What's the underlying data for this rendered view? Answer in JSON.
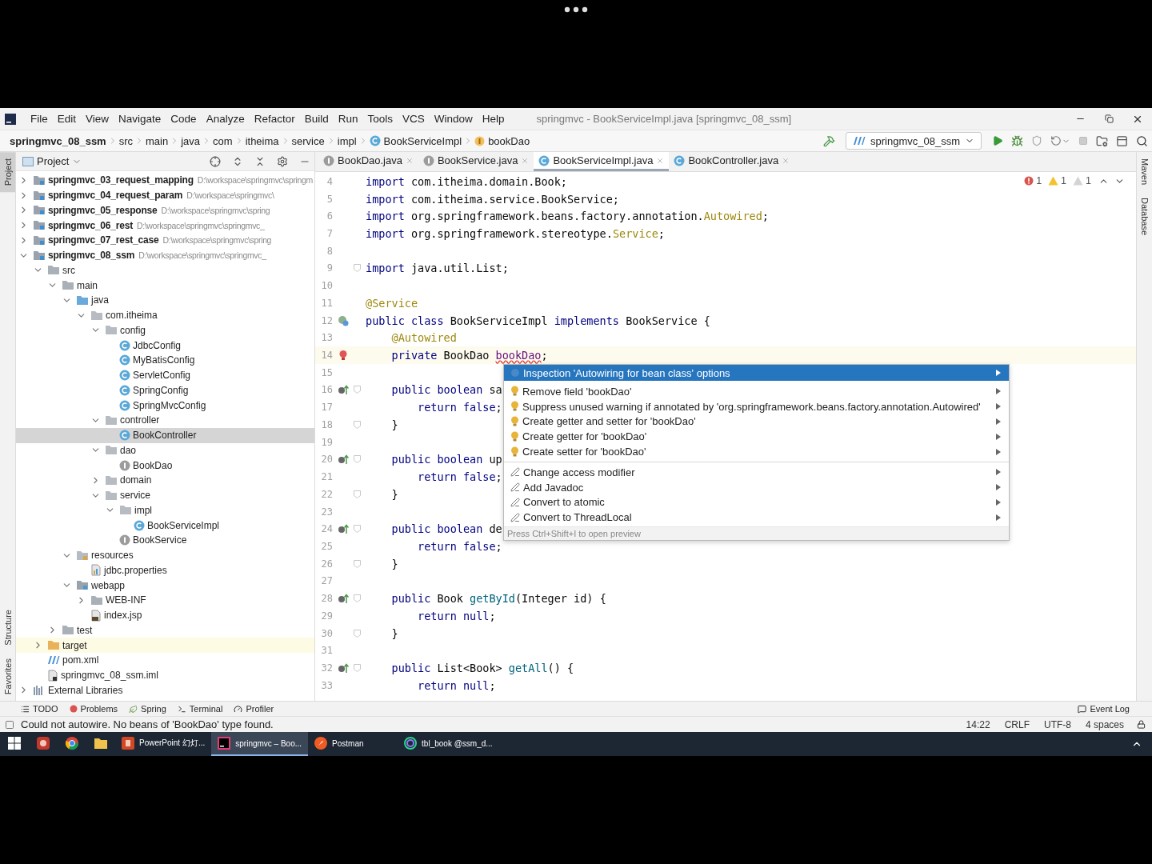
{
  "menu_bar": {
    "items": [
      "File",
      "Edit",
      "View",
      "Navigate",
      "Code",
      "Analyze",
      "Refactor",
      "Build",
      "Run",
      "Tools",
      "VCS",
      "Window",
      "Help"
    ],
    "title": "springmvc - BookServiceImpl.java [springmvc_08_ssm]"
  },
  "navigation_bar": {
    "breadcrumbs": [
      {
        "label": "springmvc_08_ssm",
        "kind": "project"
      },
      {
        "label": "src",
        "kind": "folder"
      },
      {
        "label": "main",
        "kind": "folder"
      },
      {
        "label": "java",
        "kind": "folder"
      },
      {
        "label": "com",
        "kind": "folder"
      },
      {
        "label": "itheima",
        "kind": "folder"
      },
      {
        "label": "service",
        "kind": "folder"
      },
      {
        "label": "impl",
        "kind": "folder"
      },
      {
        "label": "BookServiceImpl",
        "kind": "class"
      },
      {
        "label": "bookDao",
        "kind": "field"
      }
    ],
    "run_configuration": "springmvc_08_ssm"
  },
  "left_tool_strip": [
    {
      "label": "Project",
      "selected": true
    },
    {
      "label": "Structure",
      "selected": false
    },
    {
      "label": "Favorites",
      "selected": false
    }
  ],
  "project_panel": {
    "title": "Project",
    "tree": [
      {
        "label": "springmvc_03_request_mapping",
        "path": "D:\\workspace\\springmvc\\springm",
        "kind": "module",
        "expanded": false,
        "selected": false
      },
      {
        "label": "springmvc_04_request_param",
        "path": "D:\\workspace\\springmvc\\",
        "kind": "module",
        "expanded": false,
        "selected": false
      },
      {
        "label": "springmvc_05_response",
        "path": "D:\\workspace\\springmvc\\spring",
        "kind": "module",
        "expanded": false,
        "selected": false
      },
      {
        "label": "springmvc_06_rest",
        "path": "D:\\workspace\\springmvc\\springmvc_",
        "kind": "module",
        "expanded": false,
        "selected": false
      },
      {
        "label": "springmvc_07_rest_case",
        "path": "D:\\workspace\\springmvc\\spring",
        "kind": "module",
        "expanded": false,
        "selected": false
      },
      {
        "label": "springmvc_08_ssm",
        "path": "D:\\workspace\\springmvc\\springmvc_",
        "kind": "module",
        "expanded": true,
        "selected": false,
        "children": [
          {
            "label": "src",
            "kind": "folder",
            "expanded": true,
            "selected": false,
            "children": [
              {
                "label": "main",
                "kind": "folder",
                "expanded": true,
                "selected": false,
                "children": [
                  {
                    "label": "java",
                    "kind": "source-folder",
                    "expanded": true,
                    "selected": false,
                    "children": [
                      {
                        "label": "com.itheima",
                        "kind": "package",
                        "expanded": true,
                        "selected": false,
                        "children": [
                          {
                            "label": "config",
                            "kind": "package",
                            "expanded": true,
                            "selected": false,
                            "children": [
                              {
                                "label": "JdbcConfig",
                                "kind": "class",
                                "selected": false
                              },
                              {
                                "label": "MyBatisConfig",
                                "kind": "class",
                                "selected": false
                              },
                              {
                                "label": "ServletConfig",
                                "kind": "class",
                                "selected": false
                              },
                              {
                                "label": "SpringConfig",
                                "kind": "class",
                                "selected": false
                              },
                              {
                                "label": "SpringMvcConfig",
                                "kind": "class",
                                "selected": false
                              }
                            ]
                          },
                          {
                            "label": "controller",
                            "kind": "package",
                            "expanded": true,
                            "selected": false,
                            "children": [
                              {
                                "label": "BookController",
                                "kind": "class",
                                "selected": true
                              }
                            ]
                          },
                          {
                            "label": "dao",
                            "kind": "package",
                            "expanded": true,
                            "selected": false,
                            "children": [
                              {
                                "label": "BookDao",
                                "kind": "interface",
                                "selected": false
                              }
                            ]
                          },
                          {
                            "label": "domain",
                            "kind": "package",
                            "expanded": false,
                            "selected": false
                          },
                          {
                            "label": "service",
                            "kind": "package",
                            "expanded": true,
                            "selected": false,
                            "children": [
                              {
                                "label": "impl",
                                "kind": "package",
                                "expanded": true,
                                "selected": false,
                                "children": [
                                  {
                                    "label": "BookServiceImpl",
                                    "kind": "class",
                                    "selected": false
                                  }
                                ]
                              },
                              {
                                "label": "BookService",
                                "kind": "interface",
                                "selected": false
                              }
                            ]
                          }
                        ]
                      }
                    ]
                  },
                  {
                    "label": "resources",
                    "kind": "resources",
                    "expanded": true,
                    "selected": false,
                    "children": [
                      {
                        "label": "jdbc.properties",
                        "kind": "properties",
                        "selected": false
                      }
                    ]
                  },
                  {
                    "label": "webapp",
                    "kind": "web-folder",
                    "expanded": true,
                    "selected": false,
                    "children": [
                      {
                        "label": "WEB-INF",
                        "kind": "folder",
                        "expanded": false,
                        "selected": false
                      },
                      {
                        "label": "index.jsp",
                        "kind": "jsp",
                        "selected": false
                      }
                    ]
                  }
                ]
              },
              {
                "label": "test",
                "kind": "folder",
                "expanded": false,
                "selected": false
              }
            ]
          },
          {
            "label": "target",
            "kind": "excluded",
            "expanded": false,
            "selected": false
          },
          {
            "label": "pom.xml",
            "kind": "maven",
            "selected": false
          },
          {
            "label": "springmvc_08_ssm.iml",
            "kind": "iml",
            "selected": false
          }
        ]
      },
      {
        "label": "External Libraries",
        "kind": "libraries",
        "expanded": false,
        "selected": false
      }
    ]
  },
  "editor": {
    "tabs": [
      {
        "label": "BookDao.java",
        "kind": "interface",
        "selected": false
      },
      {
        "label": "BookService.java",
        "kind": "interface",
        "selected": false
      },
      {
        "label": "BookServiceImpl.java",
        "kind": "class",
        "selected": true
      },
      {
        "label": "BookController.java",
        "kind": "class",
        "selected": false
      }
    ],
    "inspections": {
      "errors": "1",
      "warnings": "1",
      "weak_warnings": "1"
    },
    "lines": [
      {
        "number": "4",
        "tokens": [
          {
            "kind": "kw",
            "text": "import"
          },
          {
            "kind": "text",
            "text": " com.itheima.domain.Book;"
          }
        ]
      },
      {
        "number": "5",
        "tokens": [
          {
            "kind": "kw",
            "text": "import"
          },
          {
            "kind": "text",
            "text": " com.itheima.service.BookService;"
          }
        ]
      },
      {
        "number": "6",
        "tokens": [
          {
            "kind": "kw",
            "text": "import"
          },
          {
            "kind": "text",
            "text": " org.springframework.beans.factory.annotation."
          },
          {
            "kind": "ref",
            "text": "Autowired"
          },
          {
            "kind": "text",
            "text": ";"
          }
        ]
      },
      {
        "number": "7",
        "tokens": [
          {
            "kind": "kw",
            "text": "import"
          },
          {
            "kind": "text",
            "text": " org.springframework.stereotype."
          },
          {
            "kind": "ref",
            "text": "Service"
          },
          {
            "kind": "text",
            "text": ";"
          }
        ]
      },
      {
        "number": "8"
      },
      {
        "number": "9",
        "fold": true,
        "tokens": [
          {
            "kind": "kw",
            "text": "import"
          },
          {
            "kind": "text",
            "text": " java.util.List;"
          }
        ]
      },
      {
        "number": "10"
      },
      {
        "number": "11",
        "tokens": [
          {
            "kind": "ann",
            "text": "@Service"
          }
        ]
      },
      {
        "number": "12",
        "kind": "bean-marker",
        "tokens": [
          {
            "kind": "kw",
            "text": "public class"
          },
          {
            "kind": "text",
            "text": " BookServiceImpl "
          },
          {
            "kind": "kw",
            "text": "implements"
          },
          {
            "kind": "text",
            "text": " BookService {"
          }
        ]
      },
      {
        "number": "13",
        "tokens": [
          {
            "kind": "ann",
            "text": "    @Autowired"
          }
        ]
      },
      {
        "number": "14",
        "kind": "error-marker",
        "current": true,
        "tokens": [
          {
            "kind": "kw",
            "text": "    private"
          },
          {
            "kind": "text",
            "text": " BookDao "
          },
          {
            "kind": "error",
            "text": "bookDao"
          },
          {
            "kind": "text",
            "text": ";"
          }
        ]
      },
      {
        "number": "15"
      },
      {
        "number": "16",
        "kind": "implements-marker",
        "fold": true,
        "tokens": [
          {
            "kind": "kw",
            "text": "    public boolean"
          },
          {
            "kind": "text",
            "text": " sa"
          }
        ]
      },
      {
        "number": "17",
        "tokens": [
          {
            "kind": "kw",
            "text": "        return false"
          },
          {
            "kind": "text",
            "text": ";"
          }
        ]
      },
      {
        "number": "18",
        "fold": true,
        "tokens": [
          {
            "kind": "text",
            "text": "    }"
          }
        ]
      },
      {
        "number": "19"
      },
      {
        "number": "20",
        "kind": "implements-marker",
        "fold": true,
        "tokens": [
          {
            "kind": "kw",
            "text": "    public boolean"
          },
          {
            "kind": "text",
            "text": " up"
          }
        ]
      },
      {
        "number": "21",
        "tokens": [
          {
            "kind": "kw",
            "text": "        return false"
          },
          {
            "kind": "text",
            "text": ";"
          }
        ]
      },
      {
        "number": "22",
        "fold": true,
        "tokens": [
          {
            "kind": "text",
            "text": "    }"
          }
        ]
      },
      {
        "number": "23"
      },
      {
        "number": "24",
        "kind": "implements-marker",
        "fold": true,
        "tokens": [
          {
            "kind": "kw",
            "text": "    public boolean"
          },
          {
            "kind": "text",
            "text": " de"
          }
        ]
      },
      {
        "number": "25",
        "tokens": [
          {
            "kind": "kw",
            "text": "        return false"
          },
          {
            "kind": "text",
            "text": ";"
          }
        ]
      },
      {
        "number": "26",
        "fold": true,
        "tokens": [
          {
            "kind": "text",
            "text": "    }"
          }
        ]
      },
      {
        "number": "27"
      },
      {
        "number": "28",
        "kind": "implements-marker",
        "fold": true,
        "tokens": [
          {
            "kind": "kw",
            "text": "    public"
          },
          {
            "kind": "text",
            "text": " Book "
          },
          {
            "kind": "method",
            "text": "getById"
          },
          {
            "kind": "text",
            "text": "(Integer id) {"
          }
        ]
      },
      {
        "number": "29",
        "tokens": [
          {
            "kind": "kw",
            "text": "        return null"
          },
          {
            "kind": "text",
            "text": ";"
          }
        ]
      },
      {
        "number": "30",
        "fold": true,
        "tokens": [
          {
            "kind": "text",
            "text": "    }"
          }
        ]
      },
      {
        "number": "31"
      },
      {
        "number": "32",
        "kind": "implements-marker",
        "fold": true,
        "tokens": [
          {
            "kind": "kw",
            "text": "    public"
          },
          {
            "kind": "text",
            "text": " List<Book> "
          },
          {
            "kind": "method",
            "text": "getAll"
          },
          {
            "kind": "text",
            "text": "() {"
          }
        ]
      },
      {
        "number": "33",
        "tokens": [
          {
            "kind": "kw",
            "text": "        return null"
          },
          {
            "kind": "text",
            "text": ";"
          }
        ]
      }
    ],
    "intention_menu": {
      "items": [
        {
          "label": "Inspection 'Autowiring for bean class' options",
          "kind": "inspection",
          "selected": true
        },
        {
          "label": "Remove field 'bookDao'",
          "kind": "quick-fix",
          "selected": false
        },
        {
          "label": "Suppress unused warning if annotated by 'org.springframework.beans.factory.annotation.Autowired'",
          "kind": "quick-fix",
          "selected": false
        },
        {
          "label": "Create getter and setter for 'bookDao'",
          "kind": "quick-fix",
          "selected": false
        },
        {
          "label": "Create getter for 'bookDao'",
          "kind": "quick-fix",
          "selected": false
        },
        {
          "label": "Create setter for 'bookDao'",
          "kind": "quick-fix",
          "selected": false
        },
        {
          "label": "Change access modifier",
          "kind": "intention",
          "selected": false
        },
        {
          "label": "Add Javadoc",
          "kind": "intention",
          "selected": false
        },
        {
          "label": "Convert to atomic",
          "kind": "intention",
          "selected": false
        },
        {
          "label": "Convert to ThreadLocal",
          "kind": "intention",
          "selected": false
        }
      ],
      "hint": "Press Ctrl+Shift+I to open preview"
    }
  },
  "right_tool_strip": [
    {
      "label": "Maven"
    },
    {
      "label": "Database"
    }
  ],
  "tool_window_bar": {
    "items": [
      {
        "label": "TODO",
        "kind": "todo"
      },
      {
        "label": "Problems",
        "kind": "problems"
      },
      {
        "label": "Spring",
        "kind": "spring"
      },
      {
        "label": "Terminal",
        "kind": "terminal"
      },
      {
        "label": "Profiler",
        "kind": "profiler"
      }
    ],
    "event_log": "Event Log"
  },
  "status_bar": {
    "message": "Could not autowire. No beans of 'BookDao' type found.",
    "items": [
      "14:22",
      "CRLF",
      "UTF-8",
      "4 spaces"
    ]
  },
  "taskbar": {
    "apps": [
      {
        "kind": "red-app",
        "selected": false
      },
      {
        "kind": "browser",
        "selected": false
      },
      {
        "kind": "folder",
        "selected": false
      },
      {
        "kind": "powerpoint",
        "label": "PowerPoint 幻灯...",
        "selected": false
      },
      {
        "kind": "intellij",
        "label": "springmvc – Boo...",
        "selected": true
      },
      {
        "kind": "postman",
        "label": "Postman",
        "selected": false
      },
      {
        "kind": "datagrip",
        "label": "tbl_book @ssm_d...",
        "selected": false
      }
    ]
  }
}
